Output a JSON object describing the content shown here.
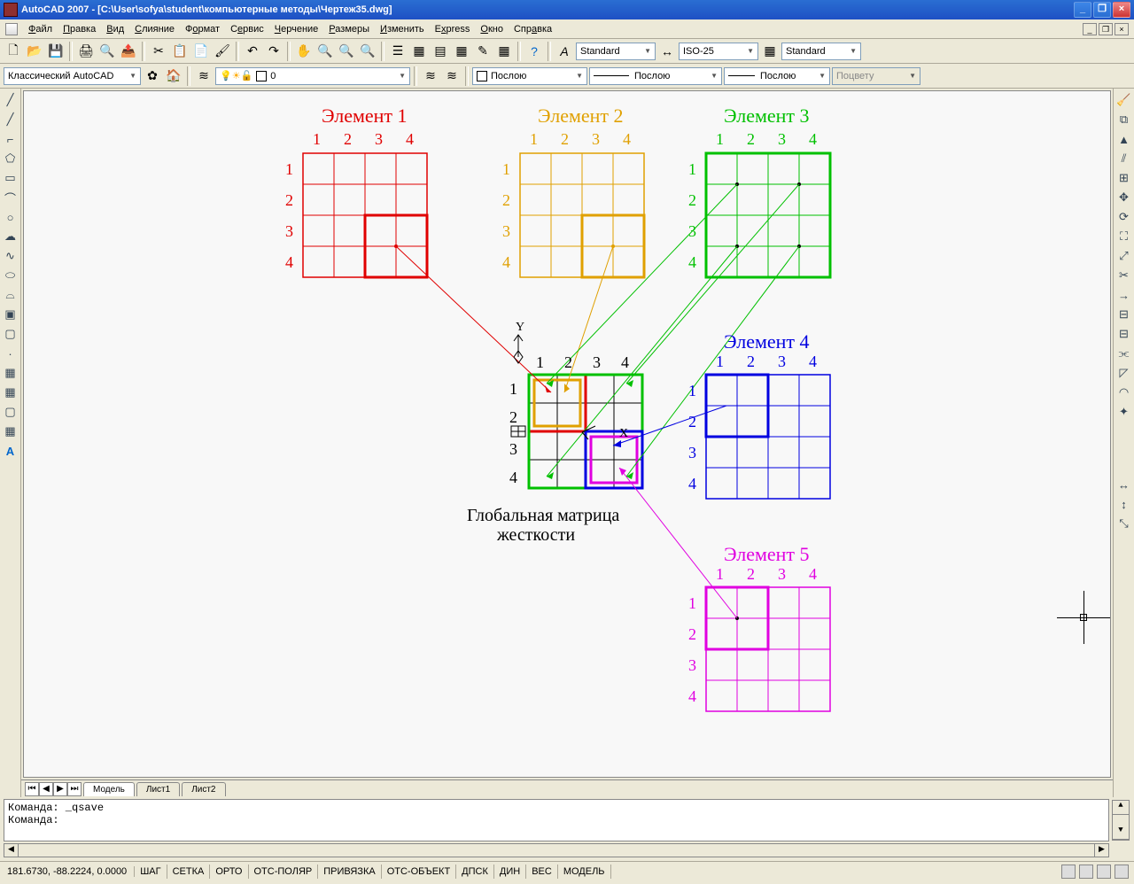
{
  "window": {
    "title": "AutoCAD 2007 - [C:\\User\\sofya\\student\\компьютерные методы\\Чертеж35.dwg]"
  },
  "menu": {
    "file": "Файл",
    "edit": "Правка",
    "view": "Вид",
    "merge": "Слияние",
    "format": "Формат",
    "service": "Сервис",
    "draw": "Черчение",
    "dim": "Размеры",
    "modify": "Изменить",
    "express": "Express",
    "window": "Окно",
    "help": "Справка"
  },
  "toolbar1": {
    "workspace": "Классический AutoCAD",
    "layer": "0",
    "textstyle": "Standard",
    "dimstyle": "ISO-25",
    "tablestyle": "Standard"
  },
  "toolbar2": {
    "color": "Послою",
    "linetype": "Послою",
    "lineweight": "Послою",
    "plotstyle": "Поцвету"
  },
  "tabs": {
    "model": "Модель",
    "layout1": "Лист1",
    "layout2": "Лист2"
  },
  "command": {
    "line1": "Команда: _qsave",
    "line2": "Команда:"
  },
  "status": {
    "coords": "181.6730, -88.2224, 0.0000",
    "snap": "ШАГ",
    "grid": "СЕТКА",
    "ortho": "ОРТО",
    "polar": "ОТС-ПОЛЯР",
    "osnap": "ПРИВЯЗКА",
    "otrack": "ОТС-ОБЪЕКТ",
    "ducs": "ДПСК",
    "dyn": "ДИН",
    "lwt": "ВЕС",
    "model": "МОДЕЛЬ"
  },
  "drawing": {
    "elem1": {
      "title": "Элемент 1",
      "color": "#e00000"
    },
    "elem2": {
      "title": "Элемент 2",
      "color": "#e0a000"
    },
    "elem3": {
      "title": "Элемент 3",
      "color": "#00c000"
    },
    "elem4": {
      "title": "Элемент 4",
      "color": "#0000e0"
    },
    "elem5": {
      "title": "Элемент 5",
      "color": "#e000e0"
    },
    "global": {
      "line1": "Глобальная матрица",
      "line2": "жесткости"
    },
    "colnums": [
      "1",
      "2",
      "3",
      "4"
    ],
    "rownums": [
      "1",
      "2",
      "3",
      "4"
    ]
  }
}
